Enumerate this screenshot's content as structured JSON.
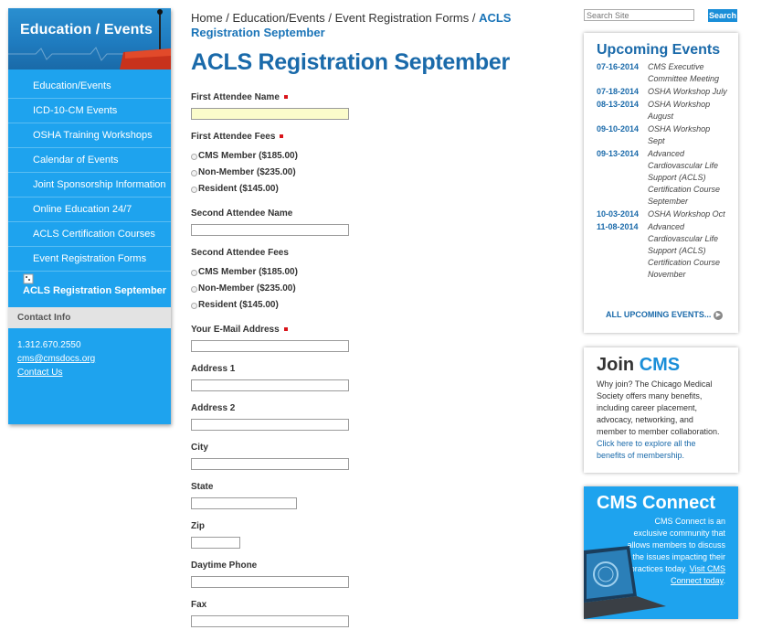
{
  "sidebar": {
    "banner_title": "Education / Events",
    "items": [
      {
        "label": "Education/Events"
      },
      {
        "label": "ICD-10-CM Events"
      },
      {
        "label": "OSHA Training Workshops"
      },
      {
        "label": "Calendar of Events"
      },
      {
        "label": "Joint Sponsorship Information"
      },
      {
        "label": "Online Education 24/7"
      },
      {
        "label": "ACLS Certification Courses"
      },
      {
        "label": "Event Registration Forms"
      }
    ],
    "active_item": "ACLS Registration September",
    "contact_head": "Contact Info",
    "phone": "1.312.670.2550",
    "email": "cms@cmsdocs.org",
    "contact_link": "Contact Us"
  },
  "breadcrumb": {
    "home": "Home",
    "sep": " / ",
    "level1": "Education/Events",
    "level2": "Event Registration Forms",
    "current": "ACLS Registration September"
  },
  "page_title": "ACLS Registration September",
  "form": {
    "first_name_label": "First Attendee Name",
    "first_fees_label": "First Attendee Fees",
    "first_fee_options": [
      "CMS Member ($185.00)",
      "Non-Member ($235.00)",
      "Resident ($145.00)"
    ],
    "second_name_label": "Second Attendee Name",
    "second_fees_label": "Second Attendee Fees",
    "second_fee_options": [
      "CMS Member ($185.00)",
      "Non-Member ($235.00)",
      "Resident ($145.00)"
    ],
    "email_label": "Your E-Mail Address",
    "address1_label": "Address 1",
    "address2_label": "Address 2",
    "city_label": "City",
    "state_label": "State",
    "zip_label": "Zip",
    "phone_label": "Daytime Phone",
    "fax_label": "Fax"
  },
  "search": {
    "placeholder": "Search Site",
    "button": "Search"
  },
  "events": {
    "title": "Upcoming Events",
    "items": [
      {
        "date": "07-16-2014",
        "desc": "CMS Executive Committee Meeting"
      },
      {
        "date": "07-18-2014",
        "desc": "OSHA Workshop July"
      },
      {
        "date": "08-13-2014",
        "desc": "OSHA Workshop August"
      },
      {
        "date": "09-10-2014",
        "desc": "OSHA Workshop Sept"
      },
      {
        "date": "09-13-2014",
        "desc": "Advanced Cardiovascular Life Support (ACLS) Certification Course September"
      },
      {
        "date": "10-03-2014",
        "desc": "OSHA Workshop Oct"
      },
      {
        "date": "11-08-2014",
        "desc": "Advanced Cardiovascular Life Support (ACLS) Certification Course November"
      }
    ],
    "all_link": "ALL UPCOMING EVENTS..."
  },
  "join": {
    "title_a": "Join",
    "title_b": "CMS",
    "text": "Why join?  The Chicago Medical Society offers many benefits, including career placement, advocacy, networking, and member to member collaboration.",
    "link": "Click here to explore all the benefits of membership."
  },
  "connect": {
    "title_a": "CMS",
    "title_b": "Connect",
    "text": "CMS Connect is an exclusive community that allows members to discuss the issues impacting their practices today.",
    "link": "Visit CMS Connect today",
    "link_suffix": "."
  },
  "colors": {
    "accent_blue": "#1ea3ee",
    "title_blue": "#1a6aaa",
    "required_red": "#d9141a",
    "highlight_field": "#fbfccb"
  }
}
